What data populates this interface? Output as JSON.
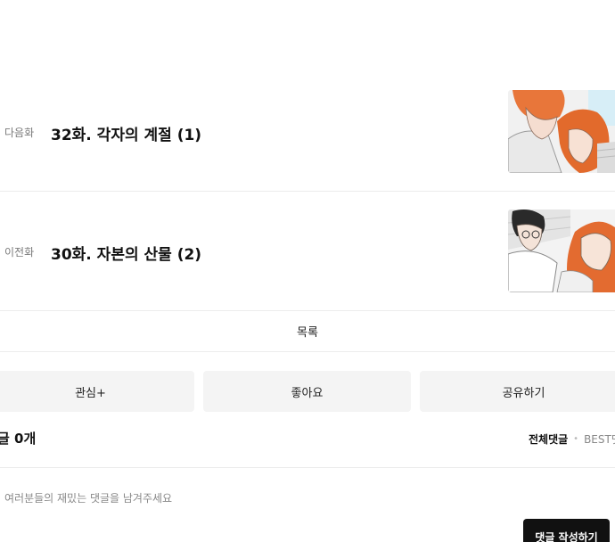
{
  "episodes": {
    "next": {
      "kind_label": "다음화",
      "title": "32화. 각자의 계절 (1)"
    },
    "prev": {
      "kind_label": "이전화",
      "title": "30화. 자본의 산물 (2)"
    }
  },
  "list_label": "목록",
  "actions": {
    "interest_label": "관심+",
    "like_label": "좋아요",
    "share_label": "공유하기"
  },
  "comments": {
    "count_label": "글 0개",
    "tab_all": "전체댓글",
    "tab_separator": "•",
    "tab_best": "BEST댓",
    "input_placeholder": "여러분들의 재밌는 댓글을 남겨주세요",
    "submit_label": "댓글 작성하기"
  },
  "colors": {
    "accent_dark": "#111111",
    "button_bg": "#f4f4f4",
    "divider": "#ececec"
  }
}
